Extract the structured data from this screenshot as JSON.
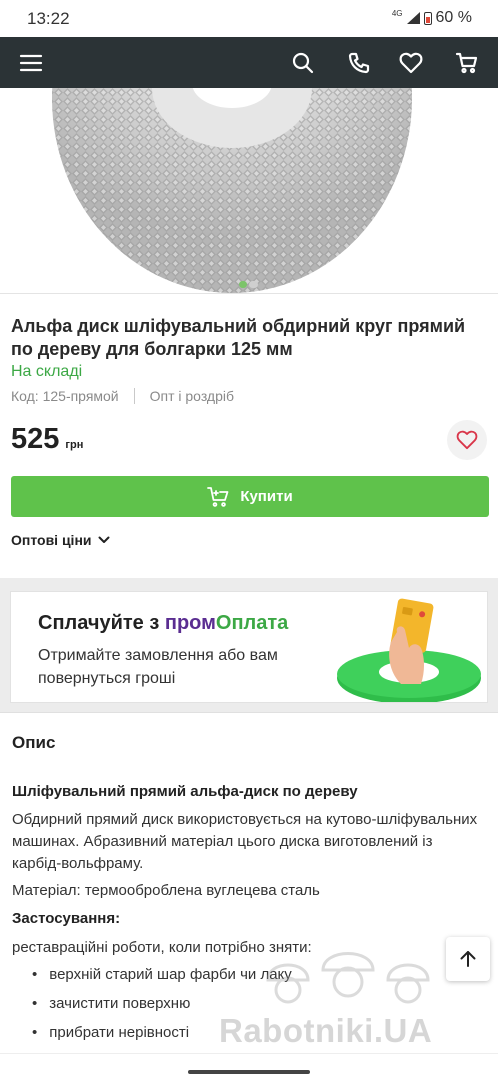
{
  "status_bar": {
    "time": "13:22",
    "network": "4G",
    "battery": "60 %"
  },
  "header": {
    "icons": [
      "menu-icon",
      "search-icon",
      "phone-icon",
      "heart-icon",
      "cart-icon"
    ]
  },
  "gallery": {
    "slides": 2,
    "active_slide": 1
  },
  "product": {
    "title": "Альфа диск шліфувальний обдирний круг прямий по дереву для болгарки 125 мм",
    "availability": "На складі",
    "code": "Код: 125-прямой",
    "sale_type": "Опт і роздріб",
    "price": "525",
    "currency": "грн",
    "buy_label": "Купити",
    "wholesale_label": "Оптові ціни"
  },
  "promo": {
    "headline_prefix": "Сплачуйте з ",
    "brand_part1": "пром",
    "brand_part2": "Оплата",
    "subtext": "Отримайте замовлення або вам повернуться гроші"
  },
  "description": {
    "heading": "Опис",
    "subheading": "Шліфувальний прямий альфа-диск по дереву",
    "paragraph": "Обдирний прямий диск використовується на кутово-шліфувальних машинах. Абразивний матеріал цього диска виготовлений із карбід-вольфраму.",
    "material": "Матеріал: термооброблена вуглецева сталь",
    "usage_heading": "Застосування:",
    "usage_intro": "реставраційні роботи, коли потрібно зняти:",
    "bullets": [
      "верхній старий шар фарби чи лаку",
      "зачистити поверхню",
      "прибрати нерівності"
    ]
  },
  "watermark": "Rabotniki.UA",
  "colors": {
    "header_bg": "#2b3336",
    "accent_green": "#5fc24b",
    "stock_green": "#3ca845",
    "brand_purple": "#5a2d91"
  }
}
